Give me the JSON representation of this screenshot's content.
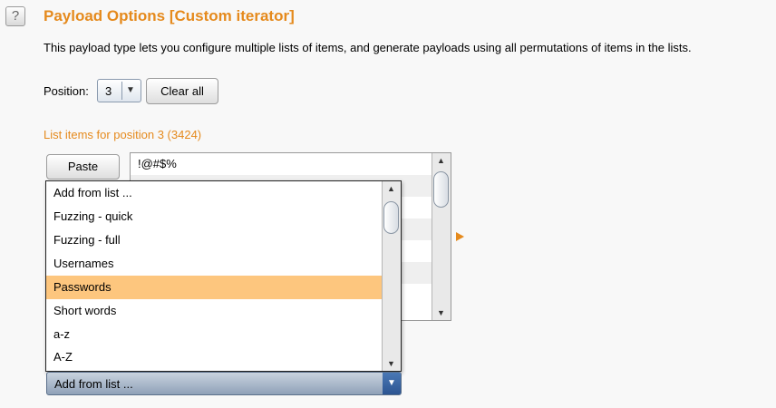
{
  "header": {
    "help_glyph": "?",
    "title": "Payload Options [Custom iterator]",
    "description": "This payload type lets you configure multiple lists of items, and generate payloads using all permutations of items in the lists."
  },
  "position": {
    "label": "Position:",
    "value": "3",
    "clear_label": "Clear all"
  },
  "list": {
    "heading": "List items for position 3 (3424)",
    "paste_label": "Paste",
    "items": [
      "!@#$%",
      "",
      "",
      "",
      "",
      "",
      ""
    ]
  },
  "dropdown": {
    "options": [
      "Add from list ...",
      "Fuzzing - quick",
      "Fuzzing - full",
      "Usernames",
      "Passwords",
      "Short words",
      "a-z",
      "A-Z"
    ],
    "highlighted": "Passwords"
  },
  "add_from_list": {
    "value": "Add from list ..."
  },
  "colors": {
    "accent_orange": "#e58a1d",
    "highlight": "#fdc67e",
    "combo_blue": "#2c5592"
  },
  "icons": {
    "dropdown_arrow": "▼",
    "scroll_up": "▲",
    "scroll_down": "▼"
  }
}
